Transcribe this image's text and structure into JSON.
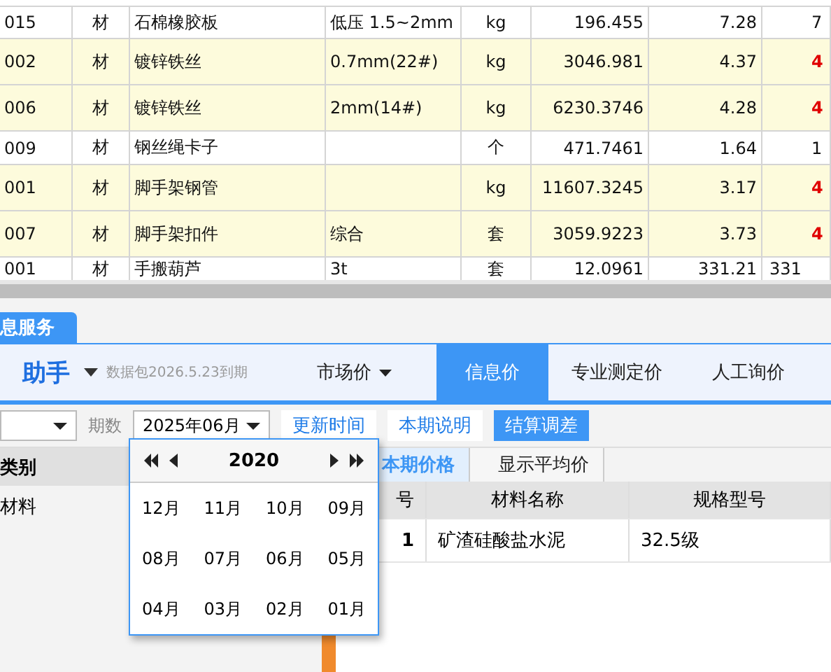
{
  "grid": {
    "rows": [
      {
        "code": "015",
        "type": "材",
        "name": "石棉橡胶板",
        "spec": "低压 1.5~2mm",
        "unit": "kg",
        "quantity": "196.455",
        "price": "7.28",
        "column_8": "7",
        "highlighted": false,
        "warning": false
      },
      {
        "code": "002",
        "type": "材",
        "name": "镀锌铁丝",
        "spec": "0.7mm(22#)",
        "unit": "kg",
        "quantity": "3046.981",
        "price": "4.37",
        "column_8": "4",
        "highlighted": true,
        "warning": true
      },
      {
        "code": "006",
        "type": "材",
        "name": "镀锌铁丝",
        "spec": "2mm(14#)",
        "unit": "kg",
        "quantity": "6230.3746",
        "price": "4.28",
        "column_8": "4",
        "highlighted": true,
        "warning": true
      },
      {
        "code": "009",
        "type": "材",
        "name": "钢丝绳卡子",
        "spec": "",
        "unit": "个",
        "quantity": "471.7461",
        "price": "1.64",
        "column_8": "1",
        "highlighted": false,
        "warning": false
      },
      {
        "code": "001",
        "type": "材",
        "name": "脚手架钢管",
        "spec": "",
        "unit": "kg",
        "quantity": "11607.3245",
        "price": "3.17",
        "column_8": "4",
        "highlighted": true,
        "warning": true
      },
      {
        "code": "007",
        "type": "材",
        "name": "脚手架扣件",
        "spec": "综合",
        "unit": "套",
        "quantity": "3059.9223",
        "price": "3.73",
        "column_8": "4",
        "highlighted": true,
        "warning": true
      },
      {
        "code": "001",
        "type": "材",
        "name": "手搬葫芦",
        "spec": "3t",
        "unit": "套",
        "quantity": "12.0961",
        "price": "331.21",
        "column_8": "331",
        "highlighted": false,
        "warning": false
      }
    ]
  },
  "panel_tabs": [
    {
      "label": "息服务",
      "selected": true
    }
  ],
  "header": {
    "brand": "助手",
    "expiry": "数据包2026.5.23到期",
    "nav": [
      {
        "label": "市场价",
        "dropdown": true,
        "selected": false
      },
      {
        "label": "信息价",
        "dropdown": false,
        "selected": true
      },
      {
        "label": "专业测定价",
        "dropdown": false,
        "selected": false
      },
      {
        "label": "人工询价",
        "dropdown": false,
        "selected": false
      }
    ]
  },
  "toolbar": {
    "period_label": "期数",
    "period_value": "2025年06月",
    "buttons": [
      {
        "label": "更新时间",
        "primary": false
      },
      {
        "label": "本期说明",
        "primary": false
      },
      {
        "label": "结算调差",
        "primary": true
      }
    ]
  },
  "category": {
    "header": "类别",
    "items": [
      {
        "label": "材料",
        "selected": false
      }
    ]
  },
  "view_tabs": [
    {
      "label": "本期价格",
      "selected": true
    },
    {
      "label": "显示平均价",
      "selected": false
    }
  ],
  "table": {
    "columns": [
      "号",
      "材料名称",
      "规格型号"
    ],
    "rows": [
      [
        "1",
        "矿渣硅酸盐水泥",
        "32.5级"
      ]
    ]
  },
  "calendar": {
    "year": "2020",
    "months": [
      "12月",
      "11月",
      "10月",
      "09月",
      "08月",
      "07月",
      "06月",
      "05月",
      "04月",
      "03月",
      "02月",
      "01月"
    ]
  }
}
